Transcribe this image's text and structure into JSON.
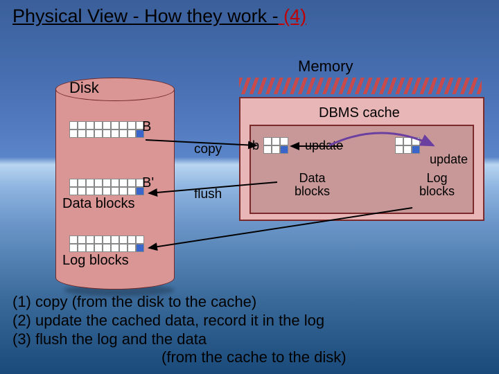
{
  "title": {
    "t1": "Physical View",
    "t2": "  - How they work -",
    "t3": " (4)"
  },
  "disk": {
    "label": "Disk",
    "B": "B",
    "Bp": "B'",
    "data_blocks": "Data blocks",
    "log_blocks": "Log blocks"
  },
  "ops": {
    "copy": "copy",
    "flush": "flush"
  },
  "memory": {
    "label": "Memory",
    "cache": "DBMS cache",
    "b": "b",
    "update": "update",
    "data_blocks": "Data\nblocks",
    "log_blocks": "Log\nblocks"
  },
  "steps": {
    "s1": "(1) copy (from the disk to the cache)",
    "s2": "(2) update the cached data, record it in the log",
    "s3": "(3) flush the log and the data",
    "s3b": "(from the cache to the disk)"
  }
}
